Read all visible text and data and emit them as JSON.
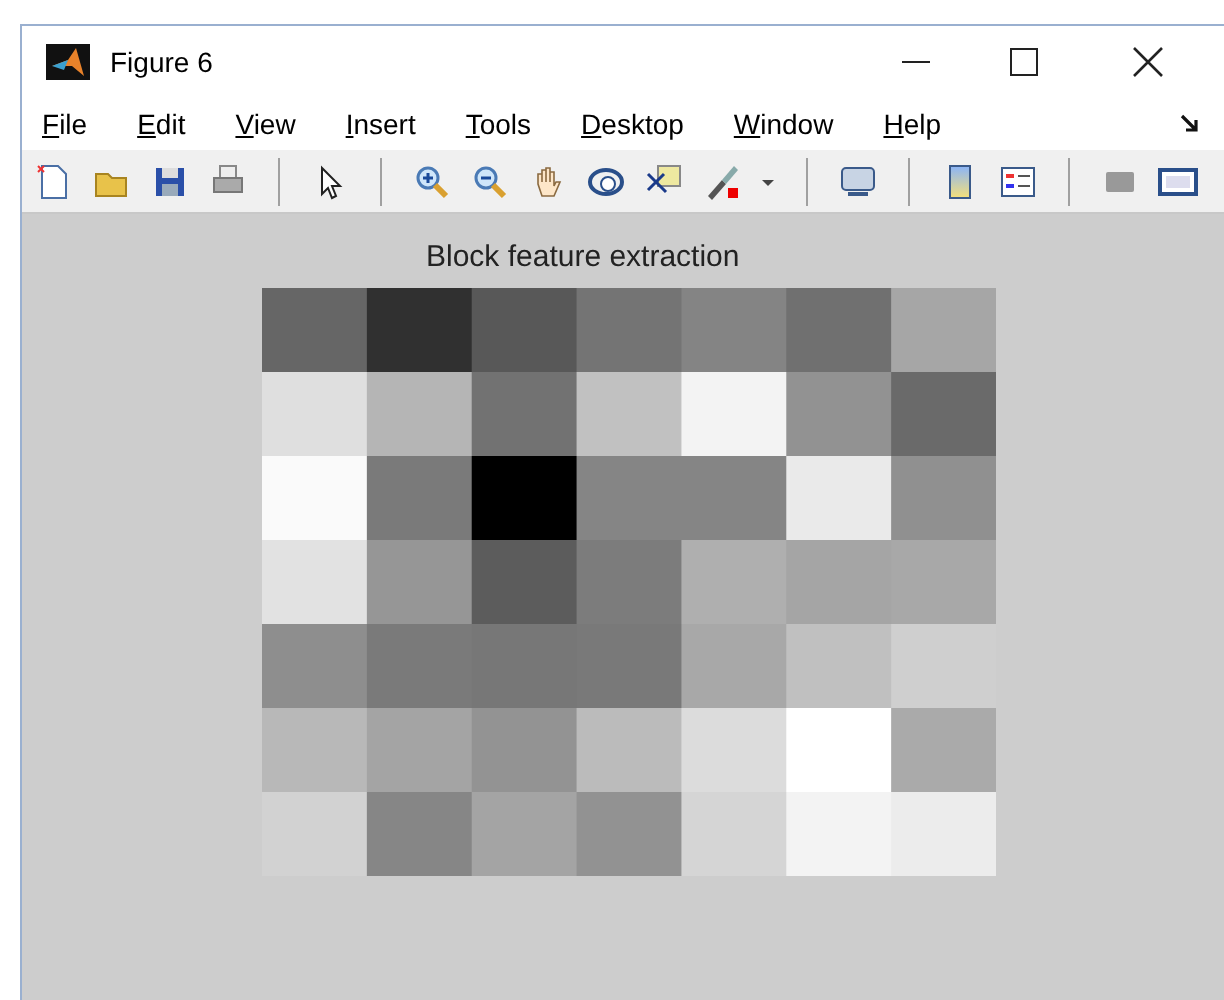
{
  "window": {
    "title": "Figure 6"
  },
  "menu": [
    "File",
    "Edit",
    "View",
    "Insert",
    "Tools",
    "Desktop",
    "Window",
    "Help"
  ],
  "toolbar": [
    {
      "kind": "new"
    },
    {
      "kind": "open"
    },
    {
      "kind": "save"
    },
    {
      "kind": "print"
    },
    {
      "kind": "sep"
    },
    {
      "kind": "pointer"
    },
    {
      "kind": "sep"
    },
    {
      "kind": "zoom-in"
    },
    {
      "kind": "zoom-out"
    },
    {
      "kind": "pan"
    },
    {
      "kind": "rotate"
    },
    {
      "kind": "datatip"
    },
    {
      "kind": "brush"
    },
    {
      "kind": "dropdown"
    },
    {
      "kind": "sep"
    },
    {
      "kind": "link"
    },
    {
      "kind": "sep"
    },
    {
      "kind": "colorbar"
    },
    {
      "kind": "legend"
    },
    {
      "kind": "sep"
    },
    {
      "kind": "hide-tools"
    },
    {
      "kind": "show-tools"
    }
  ],
  "axes": {
    "title": "Block feature extraction"
  }
}
